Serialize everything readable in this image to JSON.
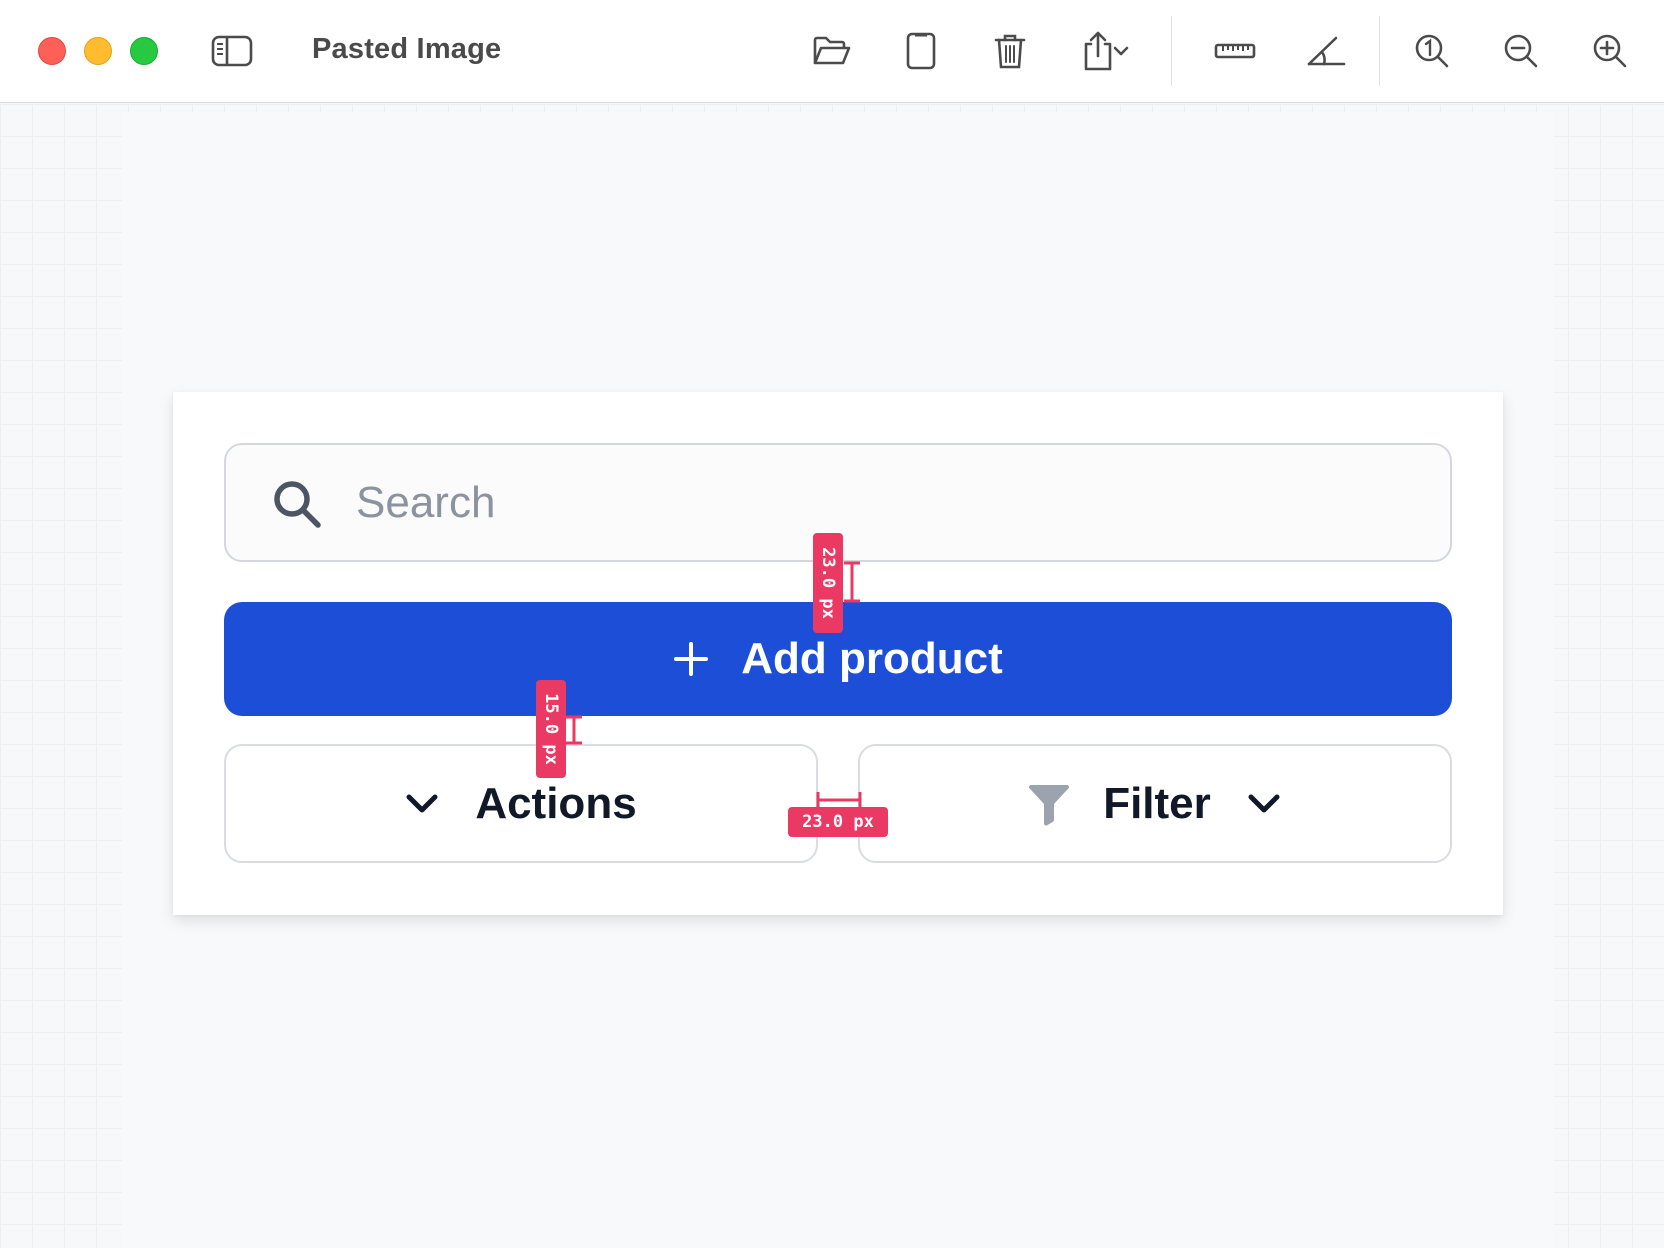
{
  "window": {
    "title": "Pasted Image"
  },
  "toolbar": {
    "icons": [
      "sidebar-toggle-icon",
      "open-folder-icon",
      "document-icon",
      "trash-icon",
      "share-icon",
      "chevron-down-icon",
      "ruler-icon",
      "angle-icon",
      "actual-size-icon",
      "zoom-out-icon",
      "zoom-in-icon"
    ]
  },
  "search": {
    "placeholder": "Search",
    "value": ""
  },
  "add_button": {
    "label": "Add product"
  },
  "actions_button": {
    "label": "Actions"
  },
  "filter_button": {
    "label": "Filter"
  },
  "measurements": {
    "search_to_add": "23.0 px",
    "add_to_actions": "15.0 px",
    "actions_to_filter": "23.0 px"
  },
  "colors": {
    "primary": "#1d4ed8",
    "measure": "#ea3a64",
    "traffic_red": "#fe5f57",
    "traffic_yellow": "#febc2e",
    "traffic_green": "#28c840"
  }
}
